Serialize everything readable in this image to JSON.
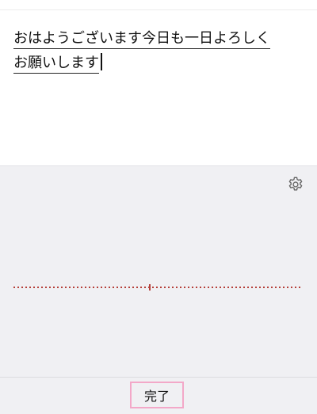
{
  "editor": {
    "lines": [
      "おはようございます今日も一日よろしく",
      "お願いします"
    ]
  },
  "dictation": {
    "settings_icon": "gear-icon",
    "waveform_color": "#b5403a"
  },
  "toolbar": {
    "done_label": "完了"
  },
  "colors": {
    "panel_bg": "#f0f0f3",
    "done_outline": "#f3a8c8"
  }
}
